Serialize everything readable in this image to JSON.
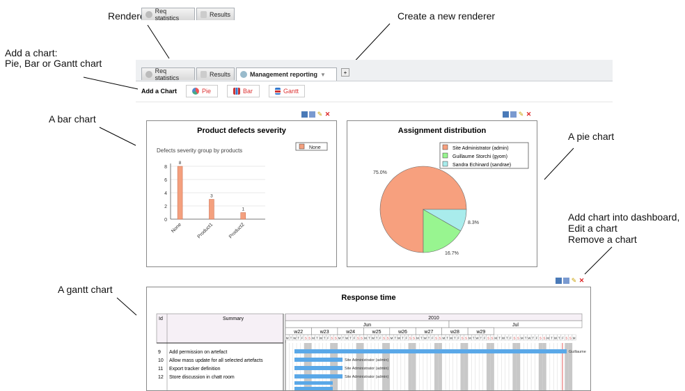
{
  "annotations": {
    "renderer_list": "Renderer list",
    "create_renderer": "Create a new renderer",
    "add_chart_line1": "Add a chart:",
    "add_chart_line2": "Pie, Bar or Gantt chart",
    "bar_chart": "A bar chart",
    "pie_chart": "A pie chart",
    "dashboard_line1": "Add chart into dashboard,",
    "dashboard_line2": "Edit a chart",
    "dashboard_line3": "Remove a chart",
    "gantt_chart": "A gantt chart"
  },
  "tabs": [
    {
      "label": "Req statistics"
    },
    {
      "label": "Results"
    },
    {
      "label": "Management reporting"
    }
  ],
  "add_tab_label": "+",
  "toolbar": {
    "add_chart_label": "Add a Chart",
    "pie_label": "Pie",
    "bar_label": "Bar",
    "gantt_label": "Gantt"
  },
  "bar_panel": {
    "title": "Product defects severity",
    "subtitle": "Defects severity group by products",
    "legend": "None"
  },
  "pie_panel": {
    "title": "Assignment distribution",
    "legend": [
      "Site Administrator (admin)",
      "Guillaume Storchi (gyom)",
      "Sandra Echinard (sandrae)"
    ]
  },
  "gantt_panel": {
    "title": "Response time",
    "col_id": "Id",
    "col_summary": "Summary",
    "year": "2010",
    "months": [
      "Jun",
      "Jul"
    ],
    "weeks": [
      "w22",
      "w23",
      "w24",
      "w25",
      "w26",
      "w27",
      "w28",
      "w29"
    ],
    "day_letters": [
      "M",
      "T",
      "W",
      "T",
      "F",
      "S",
      "S"
    ],
    "rows": [
      {
        "id": "9",
        "summary": "Add permission on artefact",
        "assignee": "Guillaume"
      },
      {
        "id": "10",
        "summary": "Allow mass update for all selected artefacts",
        "assignee": "Site Administrator (admin)"
      },
      {
        "id": "11",
        "summary": "Export tracker definition",
        "assignee": "Site Administrator (admin)"
      },
      {
        "id": "12",
        "summary": "Store discussion in chatt room",
        "assignee": "Site Administrator (admin)"
      }
    ]
  },
  "colors": {
    "bar": "#f4a07e",
    "pie_admin": "#f7a07e",
    "pie_gyom": "#98f590",
    "pie_sandrae": "#a9ecec",
    "gantt_bar": "#5aa8e8",
    "weekend": "#c8c8c8",
    "delete": "#dd2222"
  },
  "chart_data": [
    {
      "type": "bar",
      "title": "Product defects severity",
      "subtitle": "Defects severity group by products",
      "categories": [
        "None",
        "Product1",
        "Product2"
      ],
      "series": [
        {
          "name": "None",
          "values": [
            8,
            3,
            1
          ]
        }
      ],
      "ylim": [
        0,
        8
      ],
      "yticks": [
        0,
        2,
        4,
        6,
        8
      ],
      "grid": true,
      "legend": "top-right"
    },
    {
      "type": "pie",
      "title": "Assignment distribution",
      "labels": [
        "Site Administrator (admin)",
        "Guillaume Storchi (gyom)",
        "Sandra Echinard (sandrae)"
      ],
      "values": [
        75.0,
        16.7,
        8.3
      ],
      "value_labels": [
        "75.0%",
        "16.7%",
        "8.3%"
      ],
      "legend": "top-right"
    }
  ]
}
